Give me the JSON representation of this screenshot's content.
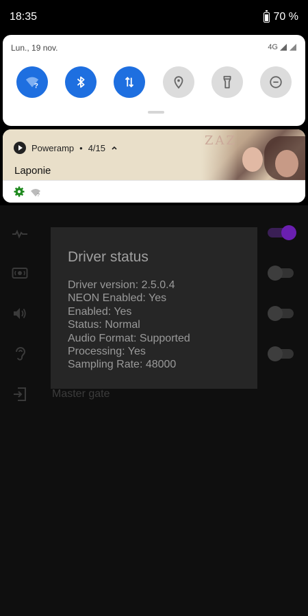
{
  "status_bar": {
    "time": "18:35",
    "battery": "70 %"
  },
  "quick_settings": {
    "date": "Lun., 19 nov.",
    "network": "4G",
    "tiles": [
      {
        "icon": "wifi-unknown-icon",
        "state": "on"
      },
      {
        "icon": "bluetooth-icon",
        "state": "on"
      },
      {
        "icon": "mobile-data-icon",
        "state": "on"
      },
      {
        "icon": "location-icon",
        "state": "off"
      },
      {
        "icon": "flashlight-icon",
        "state": "off"
      },
      {
        "icon": "do-not-disturb-icon",
        "state": "off"
      }
    ]
  },
  "media": {
    "app": "Poweramp",
    "separator": "•",
    "track_position": "4/15",
    "title": "Laponie",
    "art_text": "ZAZ"
  },
  "dialog": {
    "title": "Driver status",
    "lines": [
      "Driver version: 2.5.0.4",
      "NEON Enabled: Yes",
      "Enabled: Yes",
      "Status: Normal",
      "Audio Format: Supported",
      "Processing: Yes",
      "Sampling Rate: 48000"
    ]
  },
  "background_app": {
    "master_gate_label": "Master gate",
    "toggles": [
      {
        "icon": "waveform-icon",
        "on": true
      },
      {
        "icon": "surround-icon",
        "on": false
      },
      {
        "icon": "speaker-icon",
        "on": false
      },
      {
        "icon": "ear-icon",
        "on": false
      }
    ]
  },
  "colors": {
    "accent": "#1e6fe0",
    "toggle_accent": "#6a1fb0"
  }
}
